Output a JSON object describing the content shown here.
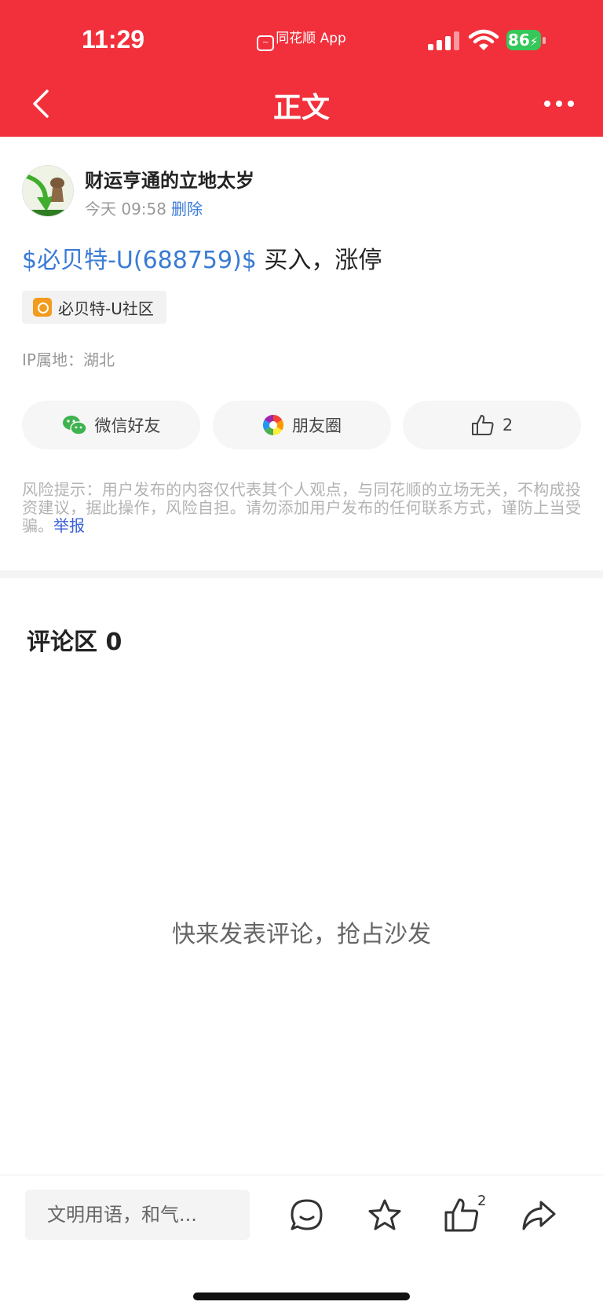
{
  "status_bar": {
    "time": "11:29",
    "app_label": "同花顺 App",
    "battery": "86"
  },
  "header": {
    "title": "正文"
  },
  "post": {
    "author": "财运亨通的立地太岁",
    "time": "今天 09:58",
    "delete_label": "删除",
    "stock_tag": "$必贝特-U(688759)$",
    "content": " 买入，涨停",
    "community": "必贝特-U社区",
    "ip": "IP属地：湖北"
  },
  "share": {
    "wechat": "微信好友",
    "moments": "朋友圈",
    "like_count": "2"
  },
  "risk": {
    "text": "风险提示：用户发布的内容仅代表其个人观点，与同花顺的立场无关，不构成投资建议，据此操作，风险自担。请勿添加用户发布的任何联系方式，谨防上当受骗。",
    "report": "举报"
  },
  "comments": {
    "title": "评论区 0",
    "empty": "快来发表评论，抢占沙发"
  },
  "bottom": {
    "input_placeholder": "文明用语，和气...",
    "like_badge": "2"
  },
  "colors": {
    "brand_red": "#f2303b",
    "link_blue": "#3a7bd5",
    "report_blue": "#3a60d8",
    "battery_green": "#35c759"
  },
  "icons": [
    "back-icon",
    "more-icon",
    "wechat-icon",
    "moments-icon",
    "thumbs-up-icon",
    "comment-icon",
    "star-icon",
    "share-icon"
  ]
}
